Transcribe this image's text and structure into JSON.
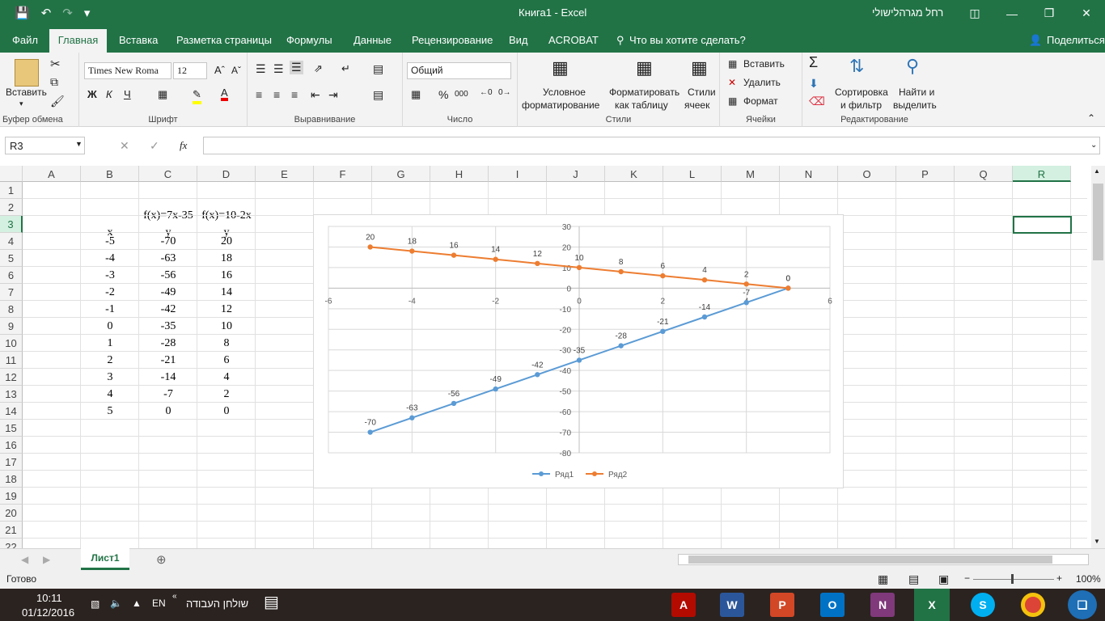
{
  "window": {
    "title": "Книга1  -  Excel",
    "user": "רחל מגרהלישולי"
  },
  "menu": [
    "Файл",
    "Главная",
    "Вставка",
    "Разметка страницы",
    "Формулы",
    "Данные",
    "Рецензирование",
    "Вид",
    "ACROBAT",
    "Что вы хотите сделать?",
    "Поделиться"
  ],
  "ribbon": {
    "paste": "Вставить",
    "clipboard": "Буфер обмена",
    "font_name": "Times New Roma",
    "font_size": "12",
    "bold": "Ж",
    "italic": "К",
    "underline": "Ч",
    "font_group": "Шрифт",
    "align_group": "Выравнивание",
    "number_format": "Общий",
    "percent": "%",
    "thousands": "000",
    "number_group": "Число",
    "cond_format_1": "Условное",
    "cond_format_2": "форматирование",
    "as_table_1": "Форматировать",
    "as_table_2": "как таблицу",
    "cell_styles_1": "Стили",
    "cell_styles_2": "ячеек",
    "styles_group": "Стили",
    "insert": "Вставить",
    "delete": "Удалить",
    "format": "Формат",
    "cells_group": "Ячейки",
    "sort_1": "Сортировка",
    "sort_2": "и фильтр",
    "find_1": "Найти и",
    "find_2": "выделить",
    "editing_group": "Редактирование"
  },
  "formula_bar": {
    "name_box": "R3",
    "fx": "fx",
    "content": ""
  },
  "columns": [
    "A",
    "B",
    "C",
    "D",
    "E",
    "F",
    "G",
    "H",
    "I",
    "J",
    "K",
    "L",
    "M",
    "N",
    "O",
    "P",
    "Q",
    "R"
  ],
  "rows": [
    "1",
    "2",
    "3",
    "4",
    "5",
    "6",
    "7",
    "8",
    "9",
    "10",
    "11",
    "12",
    "13",
    "14",
    "15",
    "16",
    "17",
    "18",
    "19",
    "20",
    "21",
    "22"
  ],
  "cells": {
    "header_c2": "f(x)=7x-35",
    "header_d2": "f(x)=10-2x",
    "header_b3": "x",
    "header_c3": "y",
    "header_d3": "y",
    "x": [
      "-5",
      "-4",
      "-3",
      "-2",
      "-1",
      "0",
      "1",
      "2",
      "3",
      "4",
      "5"
    ],
    "y1": [
      "-70",
      "-63",
      "-56",
      "-49",
      "-42",
      "-35",
      "-28",
      "-21",
      "-14",
      "-7",
      "0"
    ],
    "y2": [
      "20",
      "18",
      "16",
      "14",
      "12",
      "10",
      "8",
      "6",
      "4",
      "2",
      "0"
    ]
  },
  "chart_data": {
    "type": "scatter",
    "title": "",
    "xlim": [
      -6,
      6
    ],
    "ylim": [
      -80,
      30
    ],
    "x_ticks": [
      "-6",
      "-4",
      "-2",
      "0",
      "2",
      "4",
      "6"
    ],
    "y_ticks": [
      "30",
      "20",
      "10",
      "0",
      "-10",
      "-20",
      "-30",
      "-40",
      "-50",
      "-60",
      "-70",
      "-80"
    ],
    "x": [
      -5,
      -4,
      -3,
      -2,
      -1,
      0,
      1,
      2,
      3,
      4,
      5
    ],
    "series": [
      {
        "name": "Ряд1",
        "color": "#5b9bd5",
        "values": [
          -70,
          -63,
          -56,
          -49,
          -42,
          -35,
          -28,
          -21,
          -14,
          -7,
          0
        ]
      },
      {
        "name": "Ряд2",
        "color": "#ed7d31",
        "values": [
          20,
          18,
          16,
          14,
          12,
          10,
          8,
          6,
          4,
          2,
          0
        ]
      }
    ],
    "legend": "bottom",
    "grid": true
  },
  "sheet_tab": "Лист1",
  "status": {
    "ready": "Готово",
    "zoom": "100%"
  },
  "taskbar": {
    "time": "10:11",
    "date": "01/12/2016",
    "lang": "EN",
    "desktop": "שולחן העבודה"
  }
}
